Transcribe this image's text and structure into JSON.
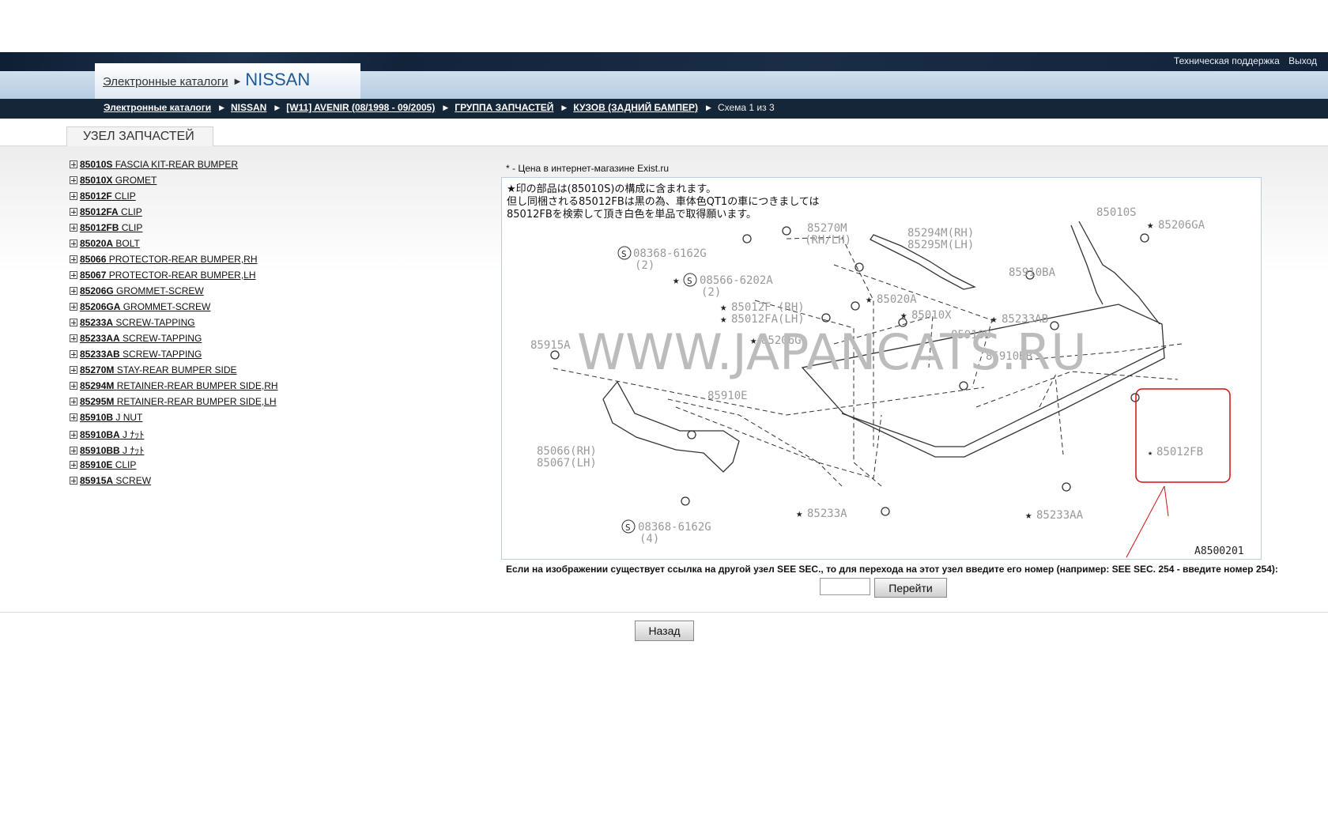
{
  "top_links": {
    "support": "Техническая поддержка",
    "logout": "Выход"
  },
  "title": {
    "catalogs": "Электронные каталоги",
    "brand": "NISSAN"
  },
  "breadcrumb": {
    "items": [
      "Электронные каталоги",
      "NISSAN",
      "[W11] AVENIR (08/1998 - 09/2005)",
      "ГРУППА ЗАПЧАСТЕЙ",
      "КУЗОВ (ЗАДНИЙ БАМПЕР)"
    ],
    "current": "Схема 1 из 3"
  },
  "section_tab": "УЗЕЛ ЗАПЧАСТЕЙ",
  "parts": [
    {
      "number": "85010S",
      "name": "FASCIA KIT-REAR BUMPER"
    },
    {
      "number": "85010X",
      "name": "GROMET"
    },
    {
      "number": "85012F",
      "name": "CLIP"
    },
    {
      "number": "85012FA",
      "name": "CLIP"
    },
    {
      "number": "85012FB",
      "name": "CLIP"
    },
    {
      "number": "85020A",
      "name": "BOLT"
    },
    {
      "number": "85066",
      "name": "PROTECTOR-REAR BUMPER,RH"
    },
    {
      "number": "85067",
      "name": "PROTECTOR-REAR BUMPER,LH"
    },
    {
      "number": "85206G",
      "name": "GROMMET-SCREW"
    },
    {
      "number": "85206GA",
      "name": "GROMMET-SCREW"
    },
    {
      "number": "85233A",
      "name": "SCREW-TAPPING"
    },
    {
      "number": "85233AA",
      "name": "SCREW-TAPPING"
    },
    {
      "number": "85233AB",
      "name": "SCREW-TAPPING"
    },
    {
      "number": "85270M",
      "name": "STAY-REAR BUMPER SIDE"
    },
    {
      "number": "85294M",
      "name": "RETAINER-REAR BUMPER SIDE,RH"
    },
    {
      "number": "85295M",
      "name": "RETAINER-REAR BUMPER SIDE,LH"
    },
    {
      "number": "85910B",
      "name": "J NUT"
    },
    {
      "number": "85910BA",
      "name": "J ﾅｯﾄ"
    },
    {
      "number": "85910BB",
      "name": "J ﾅｯﾄ"
    },
    {
      "number": "85910E",
      "name": "CLIP"
    },
    {
      "number": "85915A",
      "name": "SCREW"
    }
  ],
  "price_note": "* - Цена в интернет-магазине Exist.ru",
  "diagram": {
    "note_lines": [
      "★印の部品は(85010S)の構成に含まれます。",
      "但し同梱される85012FBは黒の為、車体色QT1の車につきましては",
      "85012FBを検索して頂き白色を単品で取得願います。"
    ],
    "watermark": "WWW.JAPANCATS.RU",
    "code": "A8500201",
    "labels": {
      "l85270m": "85270M",
      "l85270m_sub": "(RH/LH)",
      "l85294m": "85294M(RH)",
      "l85295m": "85295M(LH)",
      "l85010s": "85010S",
      "l85206ga": "85206GA",
      "l08368a": "08368-6162G",
      "l08368a_q": "(2)",
      "l08566": "08566-6202A",
      "l08566_q": "(2)",
      "l85910ba": "85910BA",
      "l85012f": "85012F (RH)",
      "l85012fa": "85012FA(LH)",
      "l85020a": "85020A",
      "l85010x": "85010X",
      "l85233ab": "85233AB",
      "l85915a": "85915A",
      "l85206g": "85206G",
      "l85910b": "85910B",
      "l85910bb": "85910BB",
      "l85910e": "85910E",
      "l85066": "85066(RH)",
      "l85067": "85067(LH)",
      "l85012fb": "85012FB",
      "l08368b": "08368-6162G",
      "l08368b_q": "(4)",
      "l85233a": "85233A",
      "l85233aa": "85233AA",
      "star": "★",
      "s_mark": "S"
    }
  },
  "see_sec_text": "Если на изображении существует ссылка на другой узел SEE SEC., то для перехода на этот узел введите его номер (например: SEE SEC. 254 - введите номер 254):",
  "goto_button": "Перейти",
  "back_button": "Назад",
  "colors": {
    "header_dark": "#152639",
    "header_light": "#b6cde2",
    "brand_blue": "#1e5a96",
    "highlight_red": "#d01010"
  }
}
